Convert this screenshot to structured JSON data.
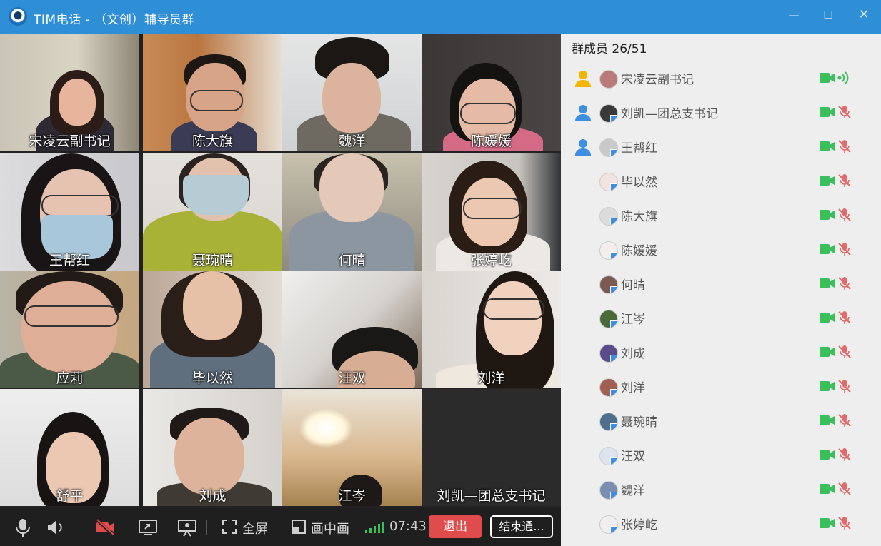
{
  "window": {
    "title": "TIM电话 - （文创）辅导员群"
  },
  "colors": {
    "titlebar": "#2e8ed6",
    "exit": "#e04c4c",
    "camera_on": "#3bbf5a",
    "mic_muted": "#e26a6a",
    "admin_gold": "#f2b500",
    "admin_blue": "#3d8fe0"
  },
  "video_tiles": [
    {
      "name": "宋凌云副书记"
    },
    {
      "name": "陈大旗"
    },
    {
      "name": "魏洋"
    },
    {
      "name": "陈媛媛"
    },
    {
      "name": "王帮红"
    },
    {
      "name": "聂琬晴"
    },
    {
      "name": "何晴"
    },
    {
      "name": "张婷屹"
    },
    {
      "name": "应莉"
    },
    {
      "name": "毕以然"
    },
    {
      "name": "汪双"
    },
    {
      "name": "刘洋"
    },
    {
      "name": "舒平"
    },
    {
      "name": "刘成"
    },
    {
      "name": "江岑"
    },
    {
      "name": "刘凯—团总支书记"
    }
  ],
  "toolbar": {
    "icons": [
      "microphone-icon",
      "speaker-icon",
      "camera-off-icon",
      "screen-share-icon",
      "presentation-icon",
      "fullscreen-icon",
      "picture-in-picture-icon",
      "signal-icon"
    ],
    "fullscreen_label": "全屏",
    "pip_label": "画中画",
    "timer": "07:43",
    "exit_label": "退出",
    "end_label": "结束通..."
  },
  "members_panel": {
    "count_label": "群成员 26/51",
    "members": [
      {
        "name": "宋凌云副书记",
        "role": "owner",
        "mic": "speaking"
      },
      {
        "name": "刘凯—团总支书记",
        "role": "admin",
        "mic": "muted"
      },
      {
        "name": "王帮红",
        "role": "admin",
        "mic": "muted"
      },
      {
        "name": "毕以然",
        "role": "",
        "mic": "muted"
      },
      {
        "name": "陈大旗",
        "role": "",
        "mic": "muted"
      },
      {
        "name": "陈媛媛",
        "role": "",
        "mic": "muted"
      },
      {
        "name": "何晴",
        "role": "",
        "mic": "muted"
      },
      {
        "name": "江岑",
        "role": "",
        "mic": "muted"
      },
      {
        "name": "刘成",
        "role": "",
        "mic": "muted"
      },
      {
        "name": "刘洋",
        "role": "",
        "mic": "muted"
      },
      {
        "name": "聂琬晴",
        "role": "",
        "mic": "muted"
      },
      {
        "name": "汪双",
        "role": "",
        "mic": "muted"
      },
      {
        "name": "魏洋",
        "role": "",
        "mic": "muted"
      },
      {
        "name": "张婷屹",
        "role": "",
        "mic": "muted"
      }
    ]
  }
}
